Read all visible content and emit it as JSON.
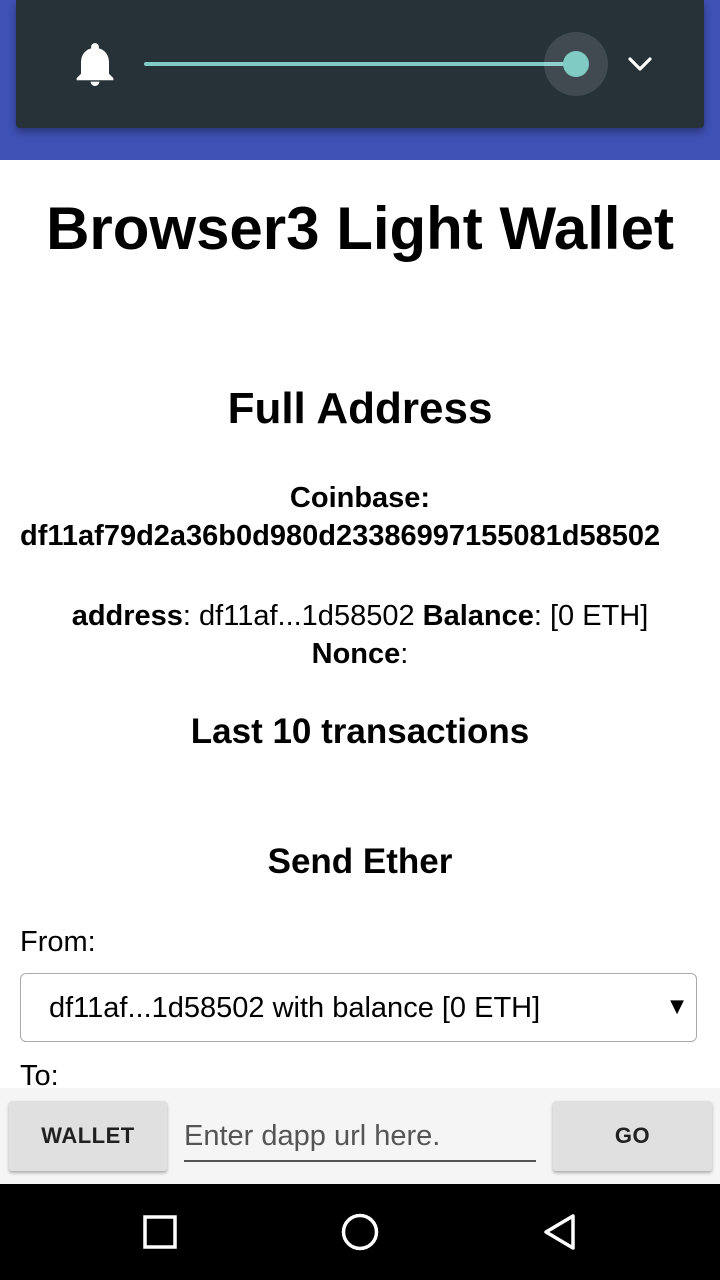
{
  "volume": {
    "icon": "bell-icon",
    "level_fraction": 1.0,
    "expand_icon": "chevron-down-icon"
  },
  "page": {
    "title": "Browser3 Light Wallet",
    "full_address_heading": "Full Address",
    "coinbase_label": "Coinbase:",
    "coinbase_value": "df11af79d2a36b0d980d23386997155081d58502",
    "address_label": "address",
    "address_value": ": df11af...1d58502 ",
    "balance_label": "Balance",
    "balance_value": ": [0 ETH]",
    "nonce_label": "Nonce",
    "nonce_value": ":",
    "last_tx_heading": "Last 10 transactions",
    "send_heading": "Send Ether",
    "from_label": "From:",
    "from_selected": "df11af...1d58502 with balance [0 ETH]",
    "to_label": "To:"
  },
  "bottom_bar": {
    "wallet_label": "WALLET",
    "url_placeholder": "Enter dapp url here.",
    "go_label": "GO"
  },
  "nav": {
    "recent": "square-icon",
    "home": "circle-icon",
    "back": "triangle-back-icon"
  },
  "colors": {
    "app_bar": "#3f51b5",
    "volume_panel": "#263238",
    "slider": "#80cbc4"
  }
}
